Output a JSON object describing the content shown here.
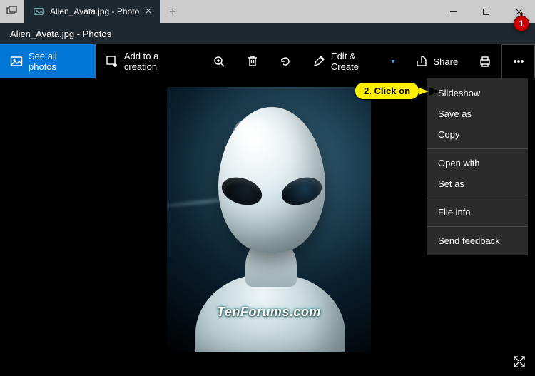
{
  "window": {
    "tab_title": "Alien_Avata.jpg - Photo",
    "minimize": "—",
    "maximize": "□",
    "close": "×",
    "newtab": "+"
  },
  "app": {
    "header_title": "Alien_Avata.jpg - Photos"
  },
  "toolbar": {
    "see_all_photos": "See all photos",
    "add_to_creation": "Add to a creation",
    "edit_create": "Edit & Create",
    "share": "Share"
  },
  "menu": {
    "items": [
      "Slideshow",
      "Save as",
      "Copy",
      "Open with",
      "Set as",
      "File info",
      "Send feedback"
    ]
  },
  "annotation": {
    "step_badge": "1",
    "callout_text": "2. Click on"
  },
  "image": {
    "watermark": "TenForums.com"
  }
}
